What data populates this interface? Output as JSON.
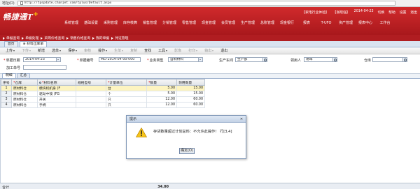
{
  "browser": {
    "address_label": "地址(D)",
    "url": "http://tpspdate.chanjet.com/tplus/Default.aspx"
  },
  "header": {
    "logo_text": "畅捷通T",
    "logo_plus": "+",
    "right_links": [
      "【家电行业体验】",
      "【张晓强】",
      "2014-04-23",
      "切换",
      "帮助",
      "设置",
      "退出"
    ],
    "nav": [
      "系统管理",
      "基础设置",
      "采购管理",
      "库存核算",
      "销售管理",
      "分销管理",
      "零售管理",
      "现金管理",
      "会员管理",
      "生产管理",
      "总账管理",
      "现金银行",
      "报表",
      "T-UFO",
      "资产管理",
      "报表中心",
      "工作台"
    ]
  },
  "breadcrumbs": [
    "单据查询",
    "单据处理",
    "采购价格查询",
    "销售价格查询",
    "我的单据",
    "凭证管理"
  ],
  "tabs": [
    {
      "label": "首页",
      "active": false
    },
    {
      "label": "材料出库单",
      "active": true
    }
  ],
  "toolbar": [
    {
      "label": "上传",
      "caret": true,
      "enabled": true
    },
    {
      "label": "下传",
      "caret": true,
      "enabled": false
    },
    {
      "label": "新增",
      "caret": false,
      "enabled": true
    },
    {
      "label": "选单",
      "caret": true,
      "enabled": true
    },
    {
      "label": "保存",
      "caret": true,
      "enabled": true
    },
    {
      "label": "审核",
      "caret": false,
      "enabled": false
    },
    {
      "label": "操作",
      "caret": true,
      "enabled": true
    },
    {
      "label": "生单",
      "caret": true,
      "enabled": false
    },
    {
      "label": "复制",
      "caret": false,
      "enabled": false
    },
    {
      "label": "查找",
      "caret": false,
      "enabled": true
    },
    {
      "label": "工具",
      "caret": true,
      "enabled": true
    },
    {
      "label": "影像",
      "caret": false,
      "enabled": false
    },
    {
      "label": "打印",
      "caret": true,
      "enabled": false
    },
    {
      "label": "输出",
      "caret": true,
      "enabled": false
    },
    {
      "label": "退出",
      "caret": false,
      "enabled": true
    }
  ],
  "form": {
    "doc_date_label": "单据日期",
    "doc_date": "2014-04-23",
    "doc_no_label": "单据编号",
    "doc_no": "MD-2014-04-00-000",
    "biz_type_label": "业务类型",
    "biz_type": "自制材料",
    "workshop_label": "生产车间",
    "workshop": "生产部",
    "handler_label": "领用人",
    "handler": "易晖",
    "warehouse_label": "仓库",
    "warehouse": "",
    "process_no_label": "加工单号",
    "process_no": ""
  },
  "subtabs": [
    {
      "label": "明细",
      "active": true
    },
    {
      "label": "汇总",
      "active": false
    }
  ],
  "grid": {
    "columns": [
      "序号",
      "仓库",
      "材料名称",
      "规格型号",
      "计量单位",
      "数量",
      "领用数量"
    ],
    "rows": [
      {
        "no": "1",
        "warehouse": "原材料仓",
        "name": "模块机机身 (F",
        "spec": "",
        "unit": "台",
        "qty": "5.00",
        "qty2": "15.00"
      },
      {
        "no": "2",
        "warehouse": "原材料仓",
        "name": "驱动中镜 (FG",
        "spec": "",
        "unit": "个",
        "qty": "5.00",
        "qty2": "15.00"
      },
      {
        "no": "3",
        "warehouse": "原材料仓",
        "name": "开关",
        "spec": "",
        "unit": "只",
        "qty": "12.00",
        "qty2": "60.00"
      },
      {
        "no": "4",
        "warehouse": "原材料仓",
        "name": "手柄",
        "spec": "",
        "unit": "只",
        "qty": "12.00",
        "qty2": "60.00"
      }
    ],
    "total_label": "合计",
    "total_qty": "34.00"
  },
  "dialog": {
    "title": "提示",
    "message": "存货数量超过计划总料：不允许此操作！ 行[3,4]",
    "ok_label": "确定(O)"
  }
}
